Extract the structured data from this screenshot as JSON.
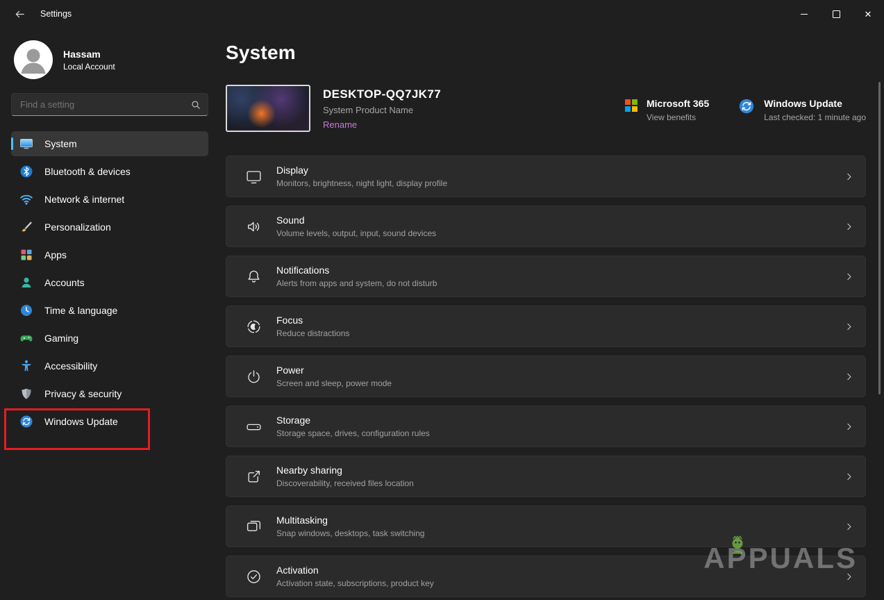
{
  "window": {
    "title": "Settings"
  },
  "sidebar": {
    "user": {
      "name": "Hassam",
      "type": "Local Account"
    },
    "search": {
      "placeholder": "Find a setting"
    },
    "items": [
      {
        "label": "System",
        "selected": true
      },
      {
        "label": "Bluetooth & devices"
      },
      {
        "label": "Network & internet"
      },
      {
        "label": "Personalization"
      },
      {
        "label": "Apps"
      },
      {
        "label": "Accounts"
      },
      {
        "label": "Time & language"
      },
      {
        "label": "Gaming"
      },
      {
        "label": "Accessibility"
      },
      {
        "label": "Privacy & security"
      },
      {
        "label": "Windows Update",
        "highlighted": true
      }
    ]
  },
  "main": {
    "title": "System",
    "device": {
      "name": "DESKTOP-QQ7JK77",
      "product": "System Product Name",
      "rename": "Rename"
    },
    "microsoft365": {
      "title": "Microsoft 365",
      "subtitle": "View benefits"
    },
    "update_status": {
      "title": "Windows Update",
      "subtitle": "Last checked: 1 minute ago"
    },
    "settings": [
      {
        "title": "Display",
        "subtitle": "Monitors, brightness, night light, display profile"
      },
      {
        "title": "Sound",
        "subtitle": "Volume levels, output, input, sound devices"
      },
      {
        "title": "Notifications",
        "subtitle": "Alerts from apps and system, do not disturb"
      },
      {
        "title": "Focus",
        "subtitle": "Reduce distractions"
      },
      {
        "title": "Power",
        "subtitle": "Screen and sleep, power mode"
      },
      {
        "title": "Storage",
        "subtitle": "Storage space, drives, configuration rules"
      },
      {
        "title": "Nearby sharing",
        "subtitle": "Discoverability, received files location"
      },
      {
        "title": "Multitasking",
        "subtitle": "Snap windows, desktops, task switching"
      },
      {
        "title": "Activation",
        "subtitle": "Activation state, subscriptions, product key"
      }
    ]
  },
  "watermark": {
    "text": "APPUALS"
  },
  "colors": {
    "accent": "#4cc2ff",
    "link": "#c77ad8",
    "annotation_red": "#e51c23",
    "card_bg": "#2b2b2b",
    "window_bg": "#1f1f1f"
  }
}
